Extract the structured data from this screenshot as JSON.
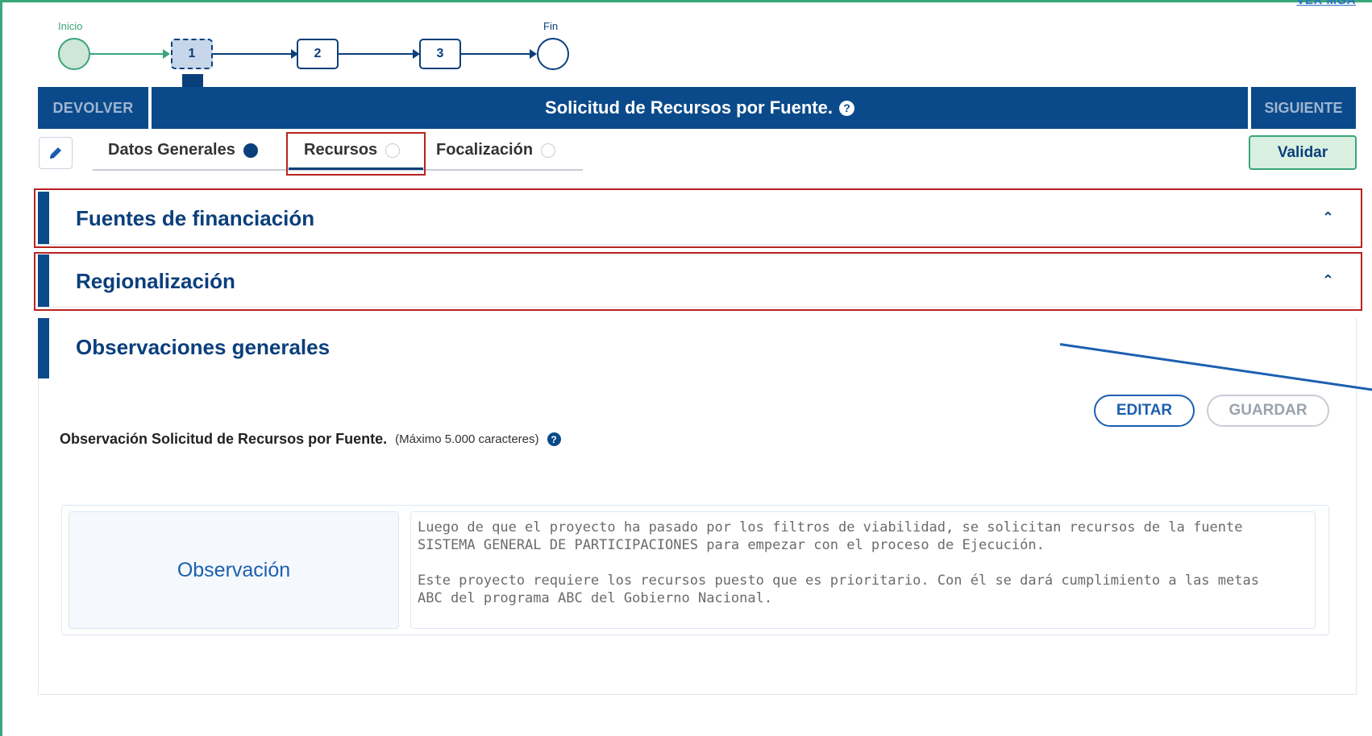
{
  "top": {
    "ver_mga": "VER MGA"
  },
  "flow": {
    "start_label": "Inicio",
    "end_label": "Fin",
    "steps": [
      "1",
      "2",
      "3"
    ],
    "active_step": "1"
  },
  "header": {
    "devolver": "DEVOLVER",
    "title": "Solicitud de Recursos por Fuente.",
    "siguiente": "SIGUIENTE",
    "help_icon": "question-circle-icon"
  },
  "subtabs": {
    "items": [
      {
        "label": "Datos Generales",
        "status": "complete"
      },
      {
        "label": "Recursos",
        "status": "pending"
      },
      {
        "label": "Focalización",
        "status": "pending"
      }
    ],
    "active": "Recursos",
    "validar": "Validar"
  },
  "sections": {
    "fuentes": "Fuentes de financiación",
    "regionalizacion": "Regionalización",
    "observaciones": "Observaciones generales"
  },
  "observaciones": {
    "editar": "EDITAR",
    "guardar": "GUARDAR",
    "label": "Observación Solicitud de Recursos por Fuente.",
    "max_note": "(Máximo 5.000 caracteres)",
    "field_label": "Observación",
    "text_p1_l1": "Luego de que el proyecto ha pasado por los filtros de viabilidad, se solicitan recursos de la fuente",
    "text_p1_l2": "SISTEMA GENERAL DE PARTICIPACIONES para empezar con el proceso de Ejecución.",
    "text_p2_l1": "Este proyecto requiere los recursos puesto que es prioritario. Con él se dará cumplimiento a las metas",
    "text_p2_l2": "ABC del programa ABC del Gobierno Nacional."
  },
  "colors": {
    "primary": "#0b4a8a",
    "accent_green": "#3aa57a",
    "highlight_red": "#b8231f",
    "link_blue": "#1c5fb0"
  }
}
